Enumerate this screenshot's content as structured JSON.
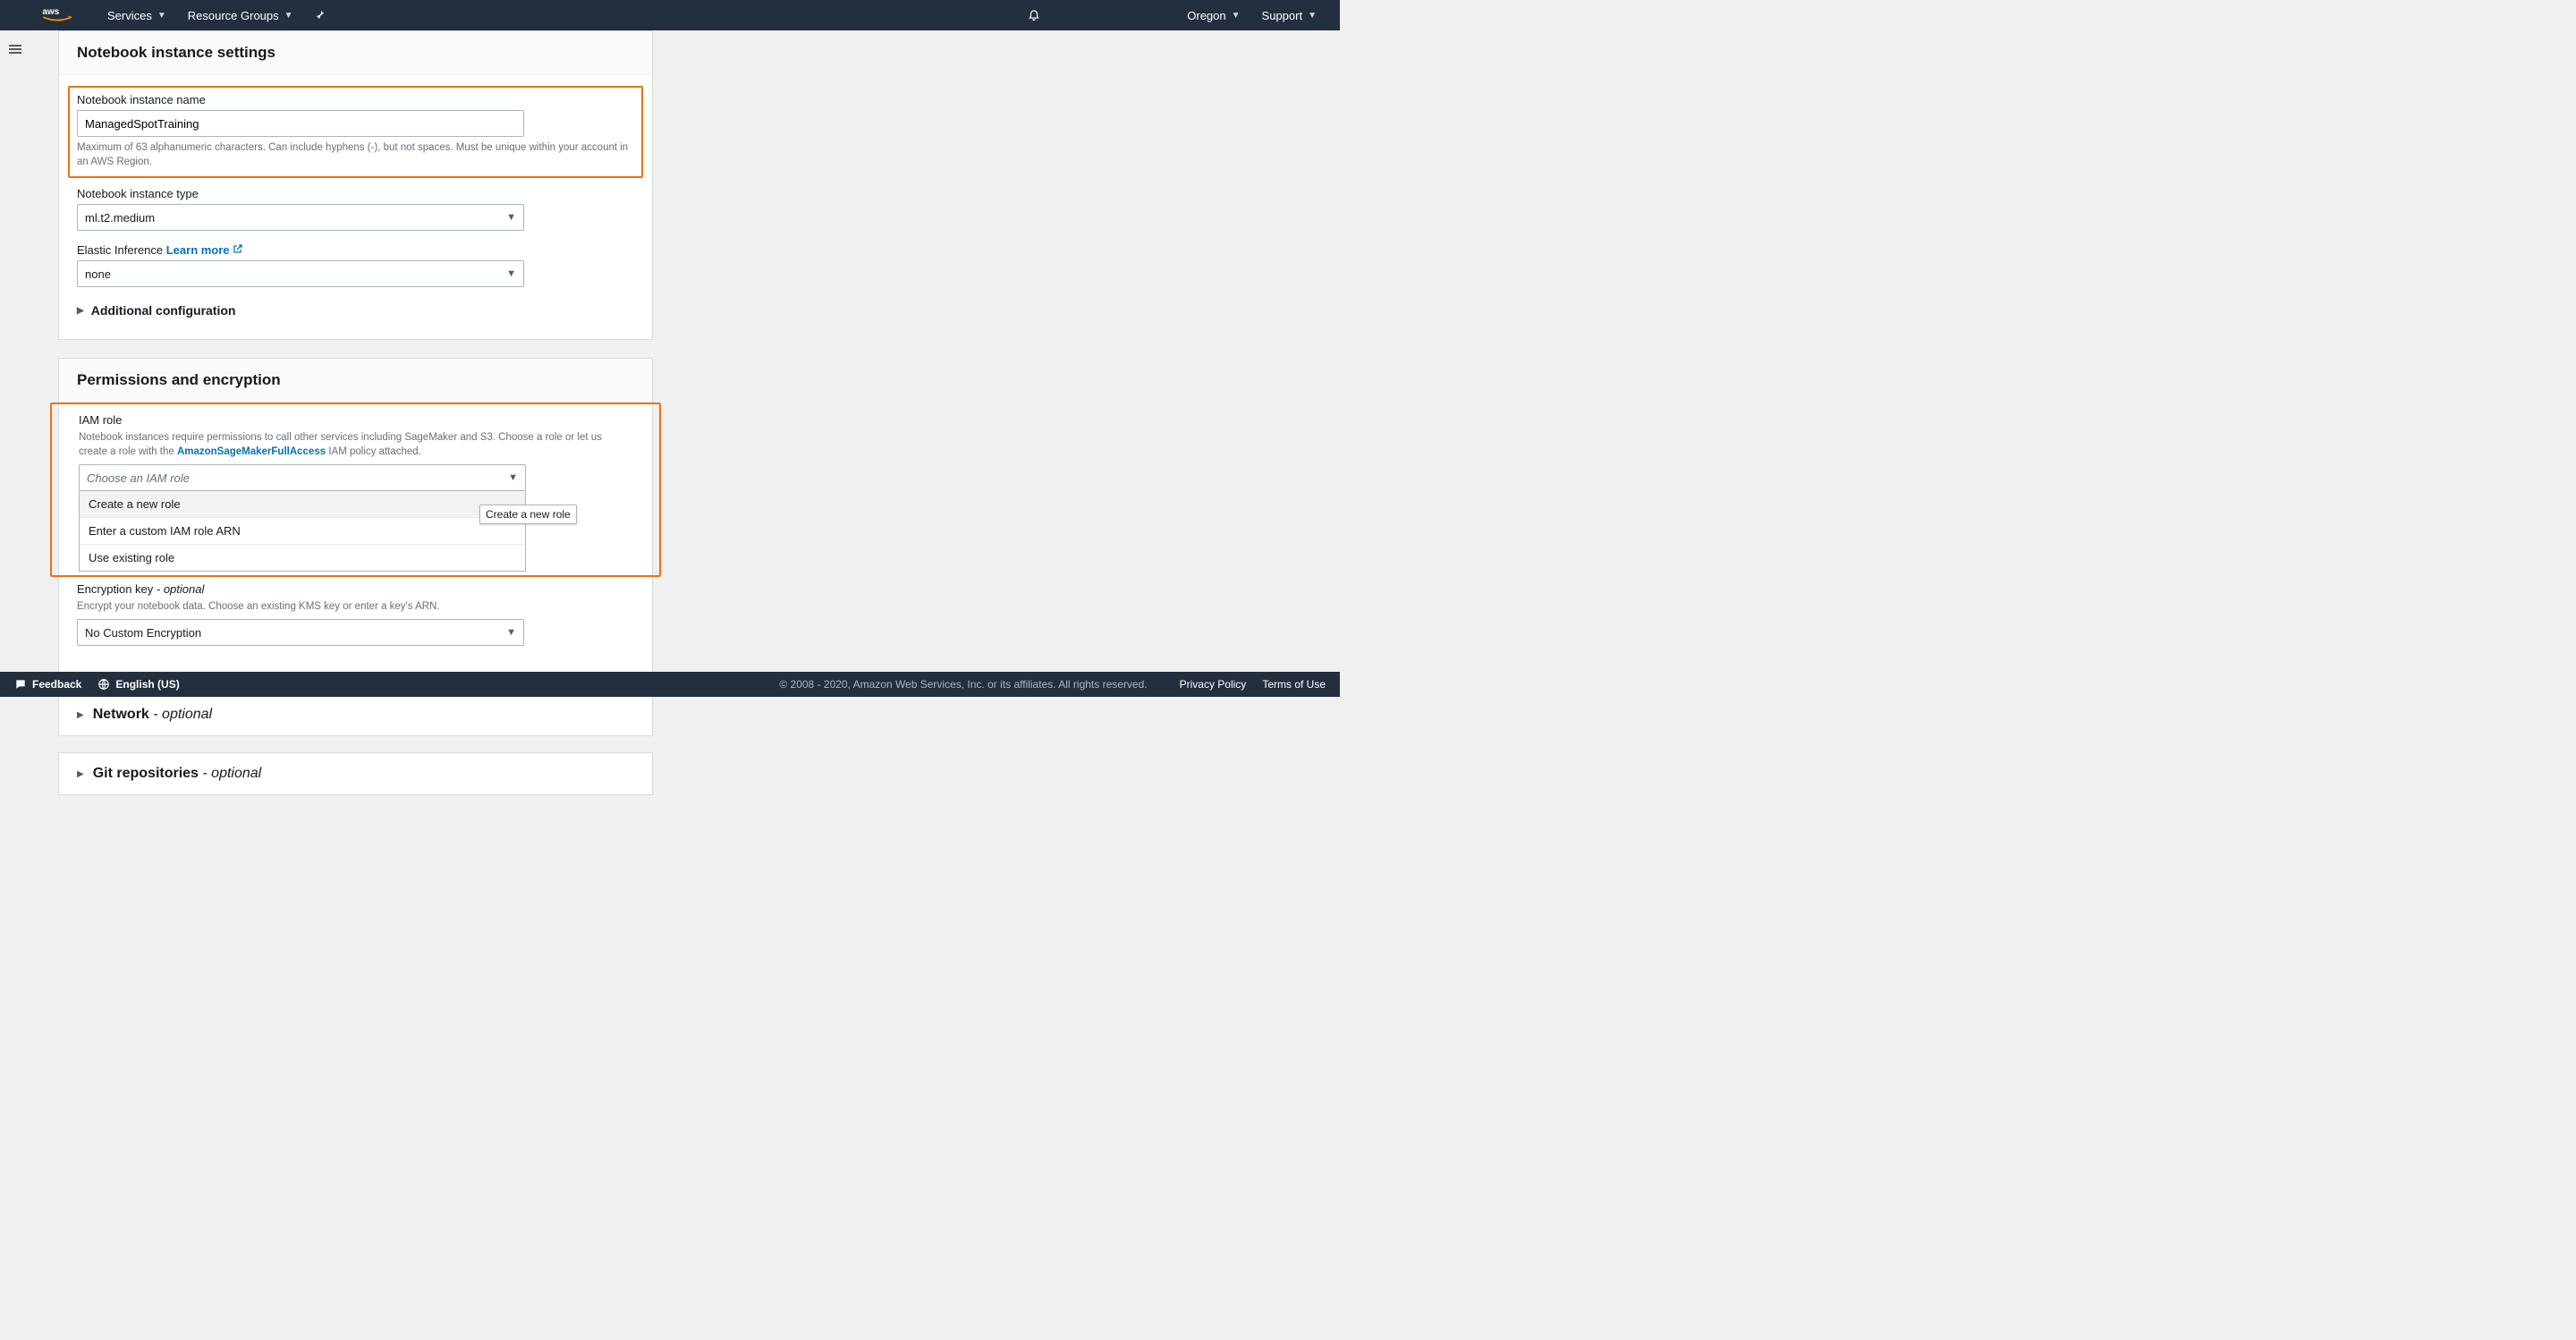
{
  "topnav": {
    "services": "Services",
    "resource_groups": "Resource Groups",
    "region": "Oregon",
    "support": "Support"
  },
  "settings_panel": {
    "title": "Notebook instance settings",
    "name_label": "Notebook instance name",
    "name_value": "ManagedSpotTraining",
    "name_hint": "Maximum of 63 alphanumeric characters. Can include hyphens (-), but not spaces. Must be unique within your account in an AWS Region.",
    "type_label": "Notebook instance type",
    "type_value": "ml.t2.medium",
    "ei_label": "Elastic Inference",
    "learn_more": "Learn more",
    "ei_value": "none",
    "additional_config": "Additional configuration"
  },
  "permissions_panel": {
    "title": "Permissions and encryption",
    "iam_label": "IAM role",
    "iam_hint_pre": "Notebook instances require permissions to call other services including SageMaker and S3. Choose a role or let us create a role with the ",
    "iam_policy_link": "AmazonSageMakerFullAccess",
    "iam_hint_post": " IAM policy attached.",
    "iam_placeholder": "Choose an IAM role",
    "iam_options": [
      "Create a new role",
      "Enter a custom IAM role ARN",
      "Use existing role"
    ],
    "tooltip": "Create a new role",
    "enc_label": "Encryption key",
    "enc_optional": " - optional",
    "enc_hint": "Encrypt your notebook data. Choose an existing KMS key or enter a key's ARN.",
    "enc_value": "No Custom Encryption"
  },
  "collapsed": {
    "network_title": "Network",
    "network_opt": " - optional",
    "git_title": "Git repositories",
    "git_opt": " - optional"
  },
  "footer": {
    "feedback": "Feedback",
    "language": "English (US)",
    "copyright": "© 2008 - 2020, Amazon Web Services, Inc. or its affiliates. All rights reserved.",
    "privacy": "Privacy Policy",
    "terms": "Terms of Use"
  }
}
